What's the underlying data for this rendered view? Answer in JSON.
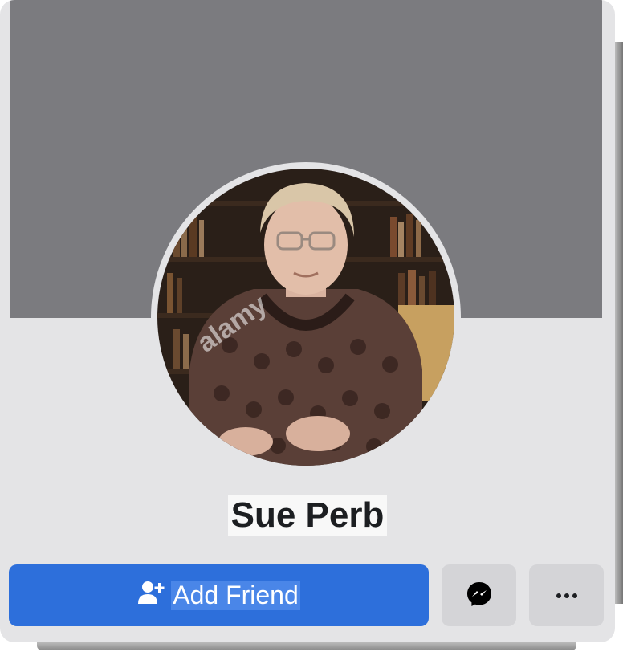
{
  "profile": {
    "name": "Sue Perb",
    "avatar_watermark": "alamy"
  },
  "actions": {
    "add_friend_label": "Add Friend",
    "add_friend_icon": "person-plus-icon",
    "message_icon": "messenger-icon",
    "more_icon": "more-dots-icon"
  },
  "colors": {
    "primary": "#2d6fdb",
    "cover": "#7b7b7f",
    "card": "#e4e4e6",
    "secondary_button": "#d4d4d7"
  }
}
